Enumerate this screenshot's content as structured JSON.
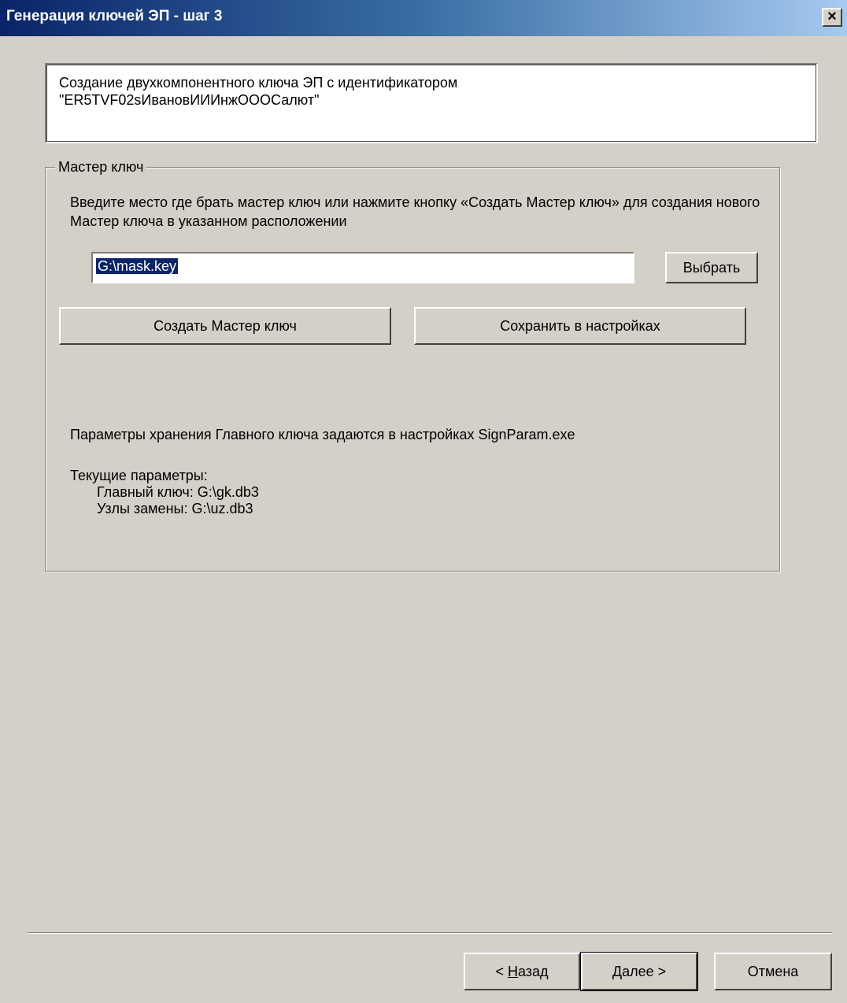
{
  "window": {
    "title": "Генерация ключей ЭП - шаг 3",
    "close_glyph": "×"
  },
  "header": {
    "line1": "Создание двухкомпонентного ключа ЭП с идентификатором",
    "line2": "\"ER5TVF02sИвановИИИнжОООСалют\""
  },
  "master_key": {
    "group_label": "Мастер ключ",
    "description": "Введите место где брать мастер ключ или нажмите кнопку «Создать Мастер ключ» для создания нового Мастер ключа в указанном расположении",
    "path_value": "G:\\mask.key",
    "browse_label": "Выбрать",
    "create_label": "Создать Мастер ключ",
    "save_label": "Сохранить в настройках",
    "storage_note": "Параметры хранения Главного ключа задаются в настройках SignParam.exe",
    "current_params_label": "Текущие параметры:",
    "main_key": "Главный ключ: G:\\gk.db3",
    "subst_nodes": "Узлы замены: G:\\uz.db3"
  },
  "footer": {
    "back_prefix": "< ",
    "back_hotkey": "Н",
    "back_rest": "азад",
    "next_hotkey": "Д",
    "next_rest": "алее >",
    "cancel_label": "Отмена"
  }
}
